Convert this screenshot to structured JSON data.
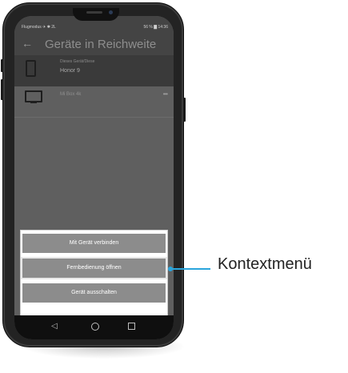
{
  "status_bar": {
    "left": "Flugmodus ✈ ✱ 2L",
    "right": "56 % ▇ 14:36"
  },
  "app_bar": {
    "back_icon": "arrow-left-icon",
    "title": "Geräte in Reichweite"
  },
  "devices": [
    {
      "icon": "smartphone-icon",
      "subtitle": "Dieses Gerät/Diese",
      "name": "Honor 9"
    },
    {
      "icon": "tv-icon",
      "subtitle": "",
      "name": "Mi Box 4k"
    }
  ],
  "context_menu": {
    "items": [
      "Mit Gerät verbinden",
      "Fernbedienung öffnen",
      "Gerät ausschalten"
    ]
  },
  "nav_bar": {
    "back": "◁",
    "home_icon": "circle-home-icon",
    "recent_icon": "square-recents-icon"
  },
  "callout": {
    "label": "Kontextmenü",
    "color": "#2aa5dc"
  }
}
